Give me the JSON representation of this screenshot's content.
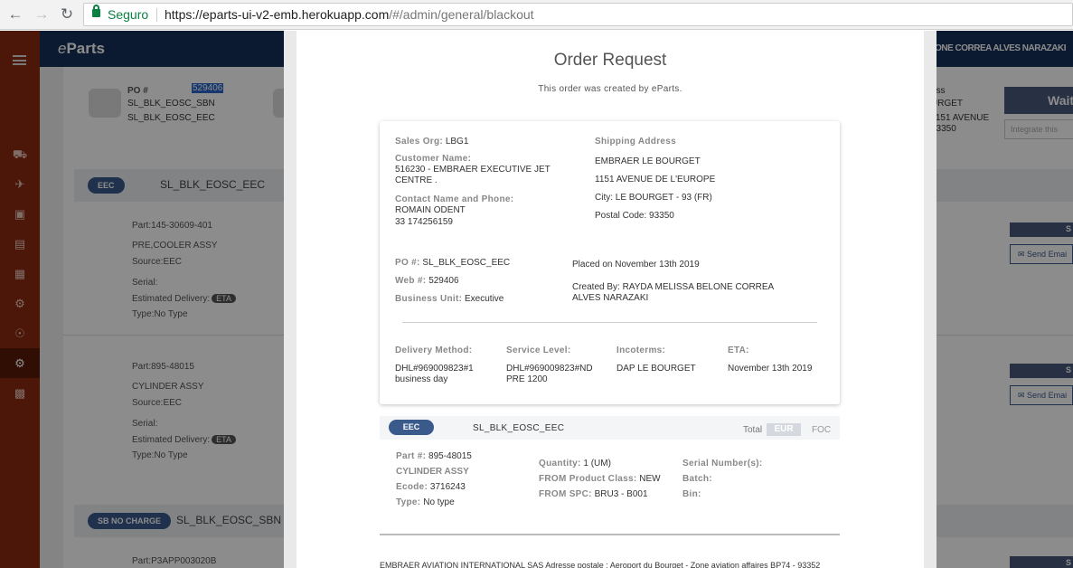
{
  "browser": {
    "secure_label": "Seguro",
    "url_host": "https://eparts-ui-v2-emb.herokuapp.com",
    "url_path": "/#/admin/general/blackout"
  },
  "app": {
    "brand_e": "e",
    "brand_rest": "Parts",
    "user_name": "LONE CORREA ALVES NARAZAKI",
    "po_label": "PO #",
    "po_number": "529406",
    "po_line1": "SL_BLK_EOSC_SBN",
    "po_line2": "SL_BLK_EOSC_EEC",
    "right_line1": "ess",
    "right_line2": "URGET",
    "right_line3": "1151 AVENUE",
    "right_line4": "93350",
    "wait_label": "Wait",
    "integrate_label": "Integrate this",
    "groups": [
      {
        "badge": "EEC",
        "title": "SL_BLK_EOSC_EEC"
      },
      {
        "badge": "SB NO CHARGE",
        "title": "SL_BLK_EOSC_SBN"
      }
    ],
    "parts": [
      {
        "part": "Part:145-30609-401",
        "desc": "PRE,COOLER ASSY",
        "source": "Source:EEC",
        "serial": "Serial:",
        "delivery": "Estimated Delivery:",
        "eta": "ETA",
        "type": "Type:No Type"
      },
      {
        "part": "Part:895-48015",
        "desc": "CYLINDER ASSY",
        "source": "Source:EEC",
        "serial": "Serial:",
        "delivery": "Estimated Delivery:",
        "eta": "ETA",
        "type": "Type:No Type"
      },
      {
        "part": "Part:P3APP003020B"
      }
    ],
    "s_label": "S",
    "send_email": "Send Emai"
  },
  "modal": {
    "title": "Order Request",
    "subtitle": "This order was created by eParts.",
    "sales_org_label": "Sales Org:",
    "sales_org": "LBG1",
    "customer_name_label": "Customer Name:",
    "customer_name_1": "516230 - EMBRAER EXECUTIVE JET",
    "customer_name_2": "CENTRE .",
    "contact_label": "Contact Name and Phone:",
    "contact_name": "ROMAIN ODENT",
    "contact_phone": "33 174256159",
    "shipping_label": "Shipping Address",
    "ship_1": "EMBRAER LE BOURGET",
    "ship_2": "1151 AVENUE DE L'EUROPE",
    "ship_3": "City: LE BOURGET - 93 (FR)",
    "ship_4": "Postal Code: 93350",
    "po_label": "PO #:",
    "po_value": "SL_BLK_EOSC_EEC",
    "web_label": "Web #:",
    "web_value": "529406",
    "bu_label": "Business Unit:",
    "bu_value": "Executive",
    "placed_on": "Placed on November 13th 2019",
    "created_by_1": "Created By: RAYDA MELISSA BELONE CORREA",
    "created_by_2": "ALVES NARAZAKI",
    "delivery_method_label": "Delivery Method:",
    "delivery_method_1": "DHL#969009823#1",
    "delivery_method_2": "business day",
    "service_level_label": "Service Level:",
    "service_level_1": "DHL#969009823#ND",
    "service_level_2": "PRE 1200",
    "incoterms_label": "Incoterms:",
    "incoterms_value": "DAP LE BOURGET",
    "eta_label": "ETA:",
    "eta_value": "November 13th 2019",
    "product": {
      "badge": "EEC",
      "title": "SL_BLK_EOSC_EEC",
      "total_label": "Total",
      "currency": "EUR",
      "foc": "FOC",
      "part_label": "Part #:",
      "part_value": "895-48015",
      "desc": "CYLINDER ASSY",
      "ecode_label": "Ecode:",
      "ecode_value": "3716243",
      "type_label": "Type:",
      "type_value": "No type",
      "qty_label": "Quantity:",
      "qty_value": "1 (UM)",
      "from_class_label": "FROM Product Class:",
      "from_class_value": "NEW",
      "from_spc_label": "FROM SPC:",
      "from_spc_value": "BRU3 - B001",
      "serial_label": "Serial Number(s):",
      "batch_label": "Batch:",
      "bin_label": "Bin:"
    },
    "footer": "EMBRAER AVIATION INTERNATIONAL SAS Adresse postale : Aeroport du Bourget - Zone aviation affaires BP74 - 93352"
  }
}
